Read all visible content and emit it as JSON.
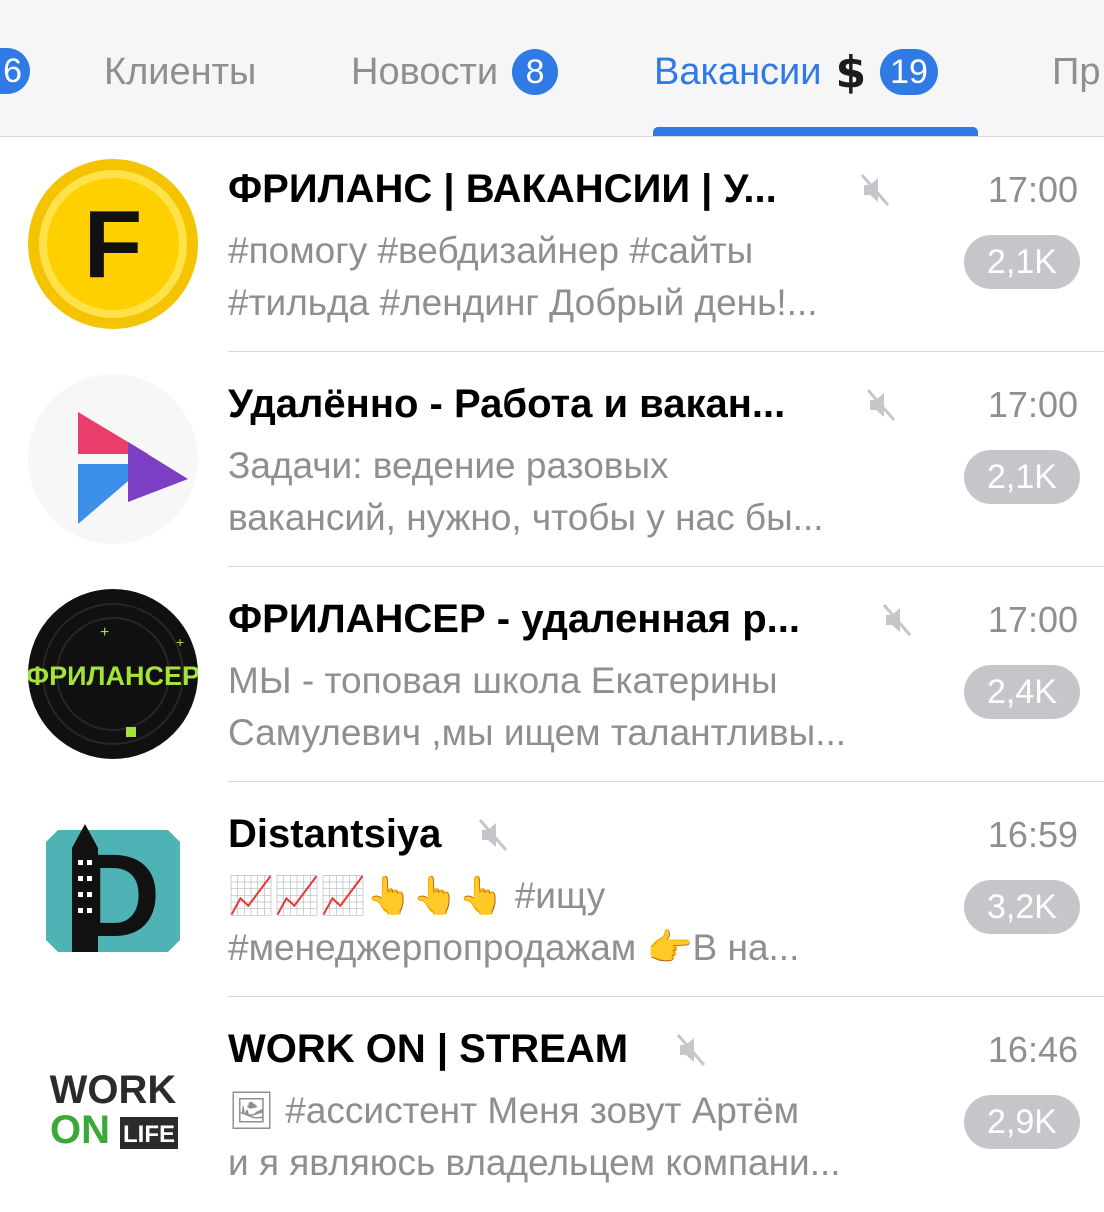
{
  "tabs": {
    "partial_left_badge": "6",
    "items": [
      {
        "label": "Клиенты",
        "badge": ""
      },
      {
        "label": "Новости",
        "badge": "8"
      },
      {
        "label": "Вакансии",
        "badge": "19",
        "active": true
      },
      {
        "label": "Пр",
        "badge": ""
      }
    ]
  },
  "colors": {
    "accent": "#2f7ae5",
    "muted_badge": "#c6c6ca",
    "secondary_text": "#8e8e93"
  },
  "chats": [
    {
      "title": "ФРИЛАНС | ВАКАНСИИ | У...",
      "time": "17:00",
      "preview_line1": "#помогу #вебдизайнер #сайты",
      "preview_line2": "#тильда #лендинг Добрый день!...",
      "badge": "2,1K",
      "muted": true,
      "avatar": {
        "letter": "F",
        "icon": "freelance-f-coin-avatar"
      }
    },
    {
      "title": "Удалённо - Работа и вакан...",
      "time": "17:00",
      "preview_line1": "Задачи: ведение разовых",
      "preview_line2": "вакансий, нужно, чтобы у нас бы...",
      "badge": "2,1K",
      "muted": true,
      "avatar": {
        "icon": "play-triangle-avatar"
      }
    },
    {
      "title": "ФРИЛАНСЕР - удаленная р...",
      "time": "17:00",
      "preview_line1": "МЫ - топовая школа Екатерины",
      "preview_line2": "Самулевич ,мы ищем талантливы...",
      "badge": "2,4K",
      "muted": true,
      "avatar": {
        "text": "ФРИЛАНСЕР",
        "icon": "frilanser-logo-avatar"
      }
    },
    {
      "title": "Distantsiya",
      "time": "16:59",
      "preview_line1": "📈📈📈👆👆👆 #ищу",
      "preview_line2": "#менеджерпопродажам 👉В на...",
      "badge": "3,2K",
      "muted": true,
      "avatar": {
        "letter": "D",
        "icon": "distantsiya-d-avatar"
      }
    },
    {
      "title": "WORK ON | STREAM",
      "time": "16:46",
      "preview_line1": "🖼 #ассистент  Меня зовут Артём",
      "preview_line2": "и я являюсь владельцем компани...",
      "badge": "2,9K",
      "muted": true,
      "avatar": {
        "text_top": "WORK",
        "text_on": "ON",
        "text_life": "LIFE",
        "icon": "work-on-life-logo-avatar"
      }
    }
  ]
}
